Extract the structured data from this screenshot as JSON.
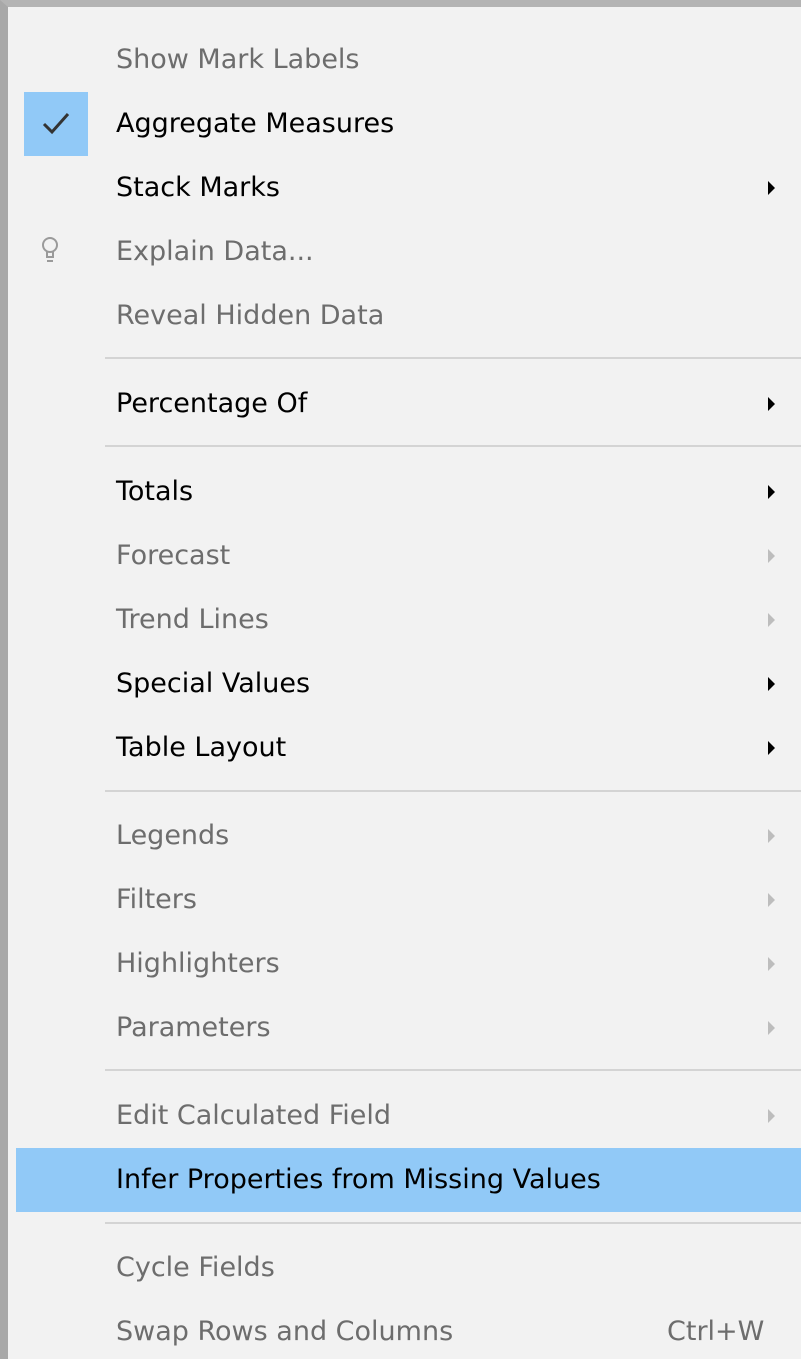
{
  "menu": {
    "items": [
      {
        "label": "Show Mark Labels",
        "enabled": false
      },
      {
        "label": "Aggregate Measures",
        "enabled": true,
        "checked": true
      },
      {
        "label": "Stack Marks",
        "enabled": true,
        "submenu": true
      },
      {
        "label": "Explain Data...",
        "enabled": false,
        "icon": "lightbulb-icon"
      },
      {
        "label": "Reveal Hidden Data",
        "enabled": false
      },
      {
        "label": "Percentage Of",
        "enabled": true,
        "submenu": true
      },
      {
        "label": "Totals",
        "enabled": true,
        "submenu": true
      },
      {
        "label": "Forecast",
        "enabled": false,
        "submenu": true
      },
      {
        "label": "Trend Lines",
        "enabled": false,
        "submenu": true
      },
      {
        "label": "Special Values",
        "enabled": true,
        "submenu": true
      },
      {
        "label": "Table Layout",
        "enabled": true,
        "submenu": true
      },
      {
        "label": "Legends",
        "enabled": false,
        "submenu": true
      },
      {
        "label": "Filters",
        "enabled": false,
        "submenu": true
      },
      {
        "label": "Highlighters",
        "enabled": false,
        "submenu": true
      },
      {
        "label": "Parameters",
        "enabled": false,
        "submenu": true
      },
      {
        "label": "Edit Calculated Field",
        "enabled": false,
        "submenu": true
      },
      {
        "label": "Infer Properties from Missing Values",
        "enabled": true,
        "highlighted": true
      },
      {
        "label": "Cycle Fields",
        "enabled": false
      },
      {
        "label": "Swap Rows and Columns",
        "enabled": false,
        "shortcut": "Ctrl+W"
      }
    ]
  },
  "colors": {
    "menu_background": "#f2f2f2",
    "highlight": "#91c9f7",
    "disabled_text": "#6d6d6d",
    "separator": "#d4d4d4"
  }
}
